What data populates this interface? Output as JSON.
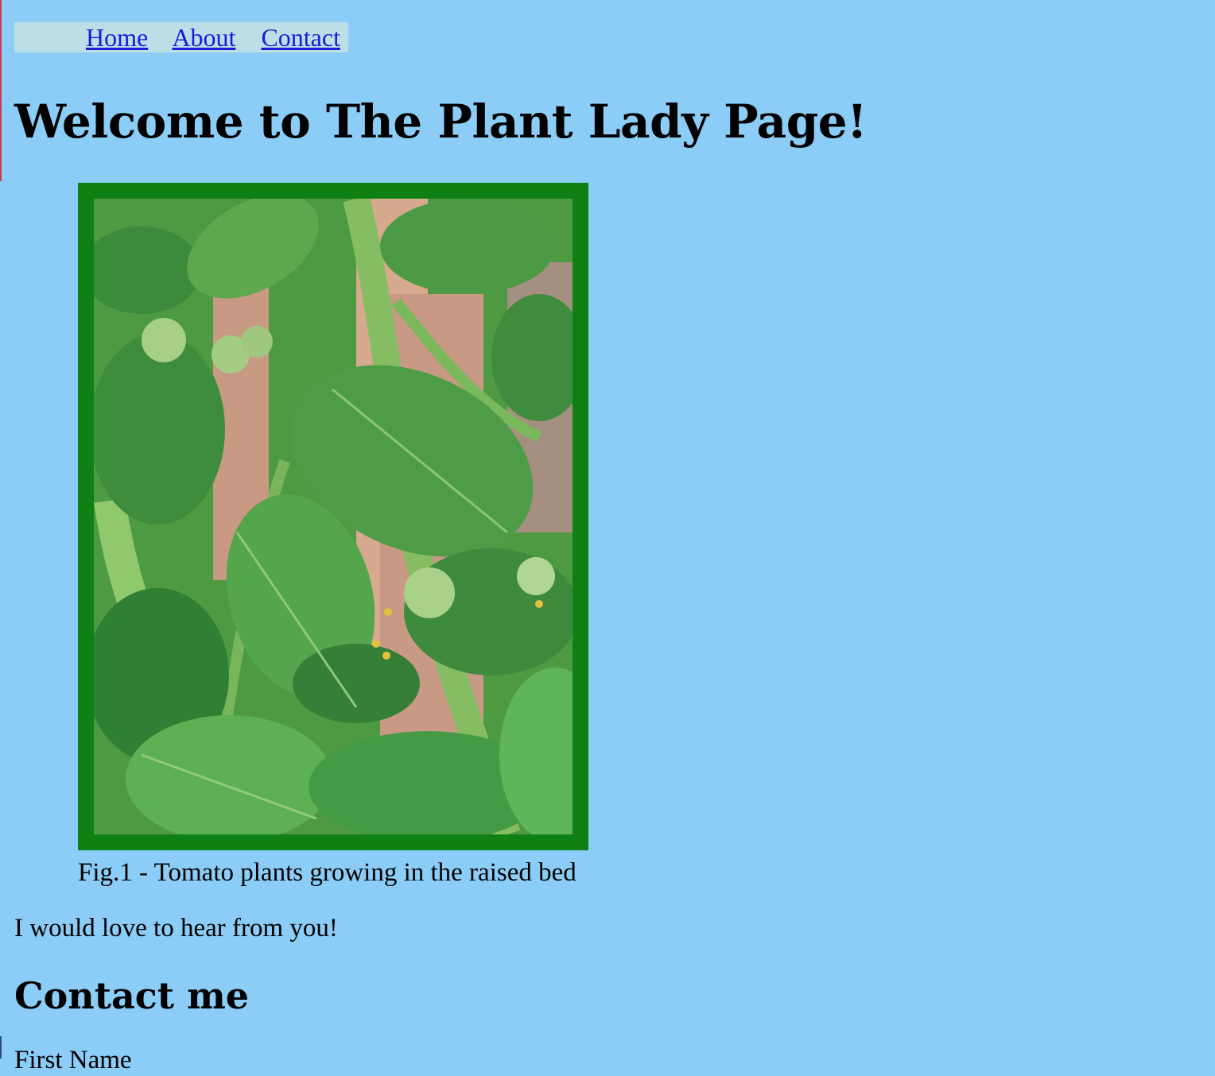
{
  "nav": {
    "items": [
      "Home",
      "About",
      "Contact"
    ]
  },
  "page": {
    "title": "Welcome to The Plant Lady Page!",
    "figure_caption": "Fig.1 - Tomato plants growing in the raised bed",
    "intro_text": "I would love to hear from you!",
    "contact_heading": "Contact me",
    "first_field_label": "First Name"
  },
  "colors": {
    "background": "#8bcdf6",
    "nav_background": "#bcdfe7",
    "link": "#1a1ad9",
    "photo_border": "#0e8014"
  }
}
